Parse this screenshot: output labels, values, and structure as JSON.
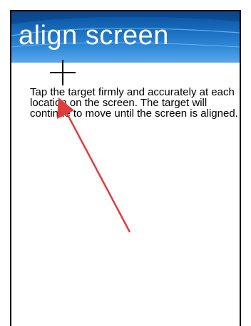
{
  "title_bar": {
    "title": "align screen"
  },
  "main": {
    "instructions": "Tap the target firmly and accurately at each location on the screen. The target will continue to move until the screen is aligned."
  },
  "colors": {
    "title_bg": "#1467b8",
    "title_text": "#ffffff",
    "arrow": "#e03c3c"
  },
  "icons": {
    "target": "crosshair-icon",
    "annotation": "red-arrow-icon"
  }
}
